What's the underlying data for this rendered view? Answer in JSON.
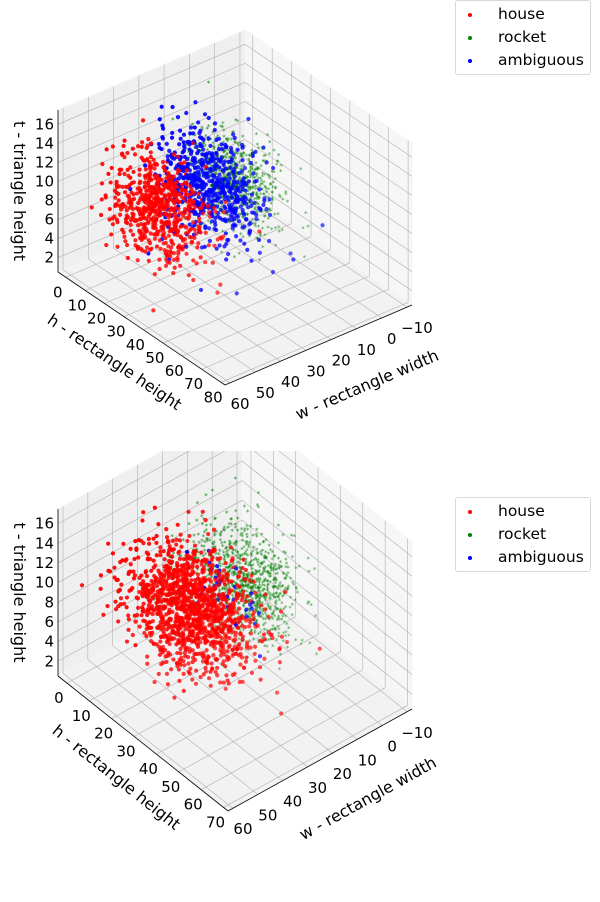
{
  "chart_data": [
    {
      "type": "scatter",
      "projection": "3d",
      "title": "",
      "xlabel": "w - rectangle width",
      "ylabel": "h - rectangle height",
      "zlabel": "t - triangle height",
      "xlim": [
        -12,
        62
      ],
      "ylim": [
        -4,
        82
      ],
      "zlim": [
        0.5,
        17.5
      ],
      "xticks": [
        "−10",
        "0",
        "10",
        "20",
        "30",
        "40",
        "50",
        "60"
      ],
      "xtick_values": [
        -10,
        0,
        10,
        20,
        30,
        40,
        50,
        60
      ],
      "yticks": [
        "0",
        "10",
        "20",
        "30",
        "40",
        "50",
        "60",
        "70",
        "80"
      ],
      "ytick_values": [
        0,
        10,
        20,
        30,
        40,
        50,
        60,
        70,
        80
      ],
      "zticks": [
        "2",
        "4",
        "6",
        "8",
        "10",
        "12",
        "14",
        "16"
      ],
      "ztick_values": [
        2,
        4,
        6,
        8,
        10,
        12,
        14,
        16
      ],
      "grid": true,
      "legend": "top-right",
      "series": [
        {
          "name": "house",
          "color": "#ff0000",
          "marker": "o",
          "count": 650,
          "center": {
            "w": 40,
            "h": 20,
            "t": 8
          },
          "spread": {
            "w": 6,
            "h": 10,
            "t": 2.2
          }
        },
        {
          "name": "rocket",
          "color": "#008000",
          "marker": "*",
          "count": 650,
          "center": {
            "w": 12,
            "h": 22,
            "t": 8
          },
          "spread": {
            "w": 5,
            "h": 10,
            "t": 2.2
          }
        },
        {
          "name": "ambiguous",
          "color": "#0000ff",
          "marker": "o",
          "count": 600,
          "center": {
            "w": 22,
            "h": 22,
            "t": 8.5
          },
          "spread": {
            "w": 6,
            "h": 12,
            "t": 2.5
          }
        }
      ]
    },
    {
      "type": "scatter",
      "projection": "3d",
      "title": "",
      "xlabel": "w - rectangle width",
      "ylabel": "h - rectangle height",
      "zlabel": "t - triangle height",
      "xlim": [
        -12,
        62
      ],
      "ylim": [
        -4,
        72
      ],
      "zlim": [
        0.5,
        17.5
      ],
      "xticks": [
        "−10",
        "0",
        "10",
        "20",
        "30",
        "40",
        "50",
        "60"
      ],
      "xtick_values": [
        -10,
        0,
        10,
        20,
        30,
        40,
        50,
        60
      ],
      "yticks": [
        "0",
        "10",
        "20",
        "30",
        "40",
        "50",
        "60",
        "70"
      ],
      "ytick_values": [
        0,
        10,
        20,
        30,
        40,
        50,
        60,
        70
      ],
      "zticks": [
        "2",
        "4",
        "6",
        "8",
        "10",
        "12",
        "14",
        "16"
      ],
      "ztick_values": [
        2,
        4,
        6,
        8,
        10,
        12,
        14,
        16
      ],
      "grid": true,
      "legend": "top-right",
      "series": [
        {
          "name": "house",
          "color": "#ff0000",
          "marker": "o",
          "count": 1300,
          "center": {
            "w": 32,
            "h": 22,
            "t": 8
          },
          "spread": {
            "w": 8,
            "h": 12,
            "t": 2.3
          }
        },
        {
          "name": "rocket",
          "color": "#008000",
          "marker": "*",
          "count": 900,
          "center": {
            "w": 10,
            "h": 22,
            "t": 7.5
          },
          "spread": {
            "w": 6,
            "h": 10,
            "t": 2.2
          }
        },
        {
          "name": "ambiguous",
          "color": "#0000ff",
          "marker": "o",
          "count": 40,
          "center": {
            "w": 20,
            "h": 22,
            "t": 8
          },
          "spread": {
            "w": 1.5,
            "h": 8,
            "t": 2
          }
        }
      ]
    }
  ]
}
